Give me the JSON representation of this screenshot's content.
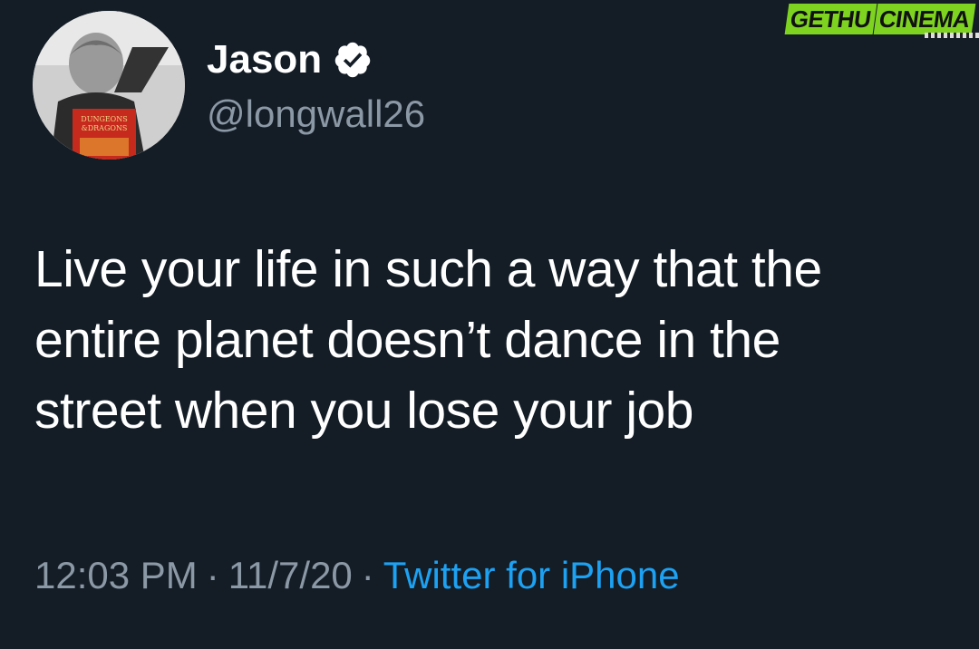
{
  "author": {
    "display_name": "Jason",
    "handle": "@longwall26",
    "verified": true,
    "avatar_book_text_1": "DUNGEONS",
    "avatar_book_text_2": "&DRAGONS"
  },
  "tweet": {
    "text_lines": [
      "Live your life in such a way that the",
      "entire planet doesn’t dance in the",
      "street when you lose your job"
    ]
  },
  "meta": {
    "time": "12:03 PM",
    "separator": "·",
    "date": "11/7/20",
    "source": "Twitter for iPhone"
  },
  "watermark": {
    "part1": "GETHU",
    "part2": "CINEMA"
  },
  "colors": {
    "background": "#141d26",
    "text_primary": "#ffffff",
    "text_secondary": "#8b98a5",
    "link": "#1da1f2",
    "watermark": "#7ed321"
  }
}
